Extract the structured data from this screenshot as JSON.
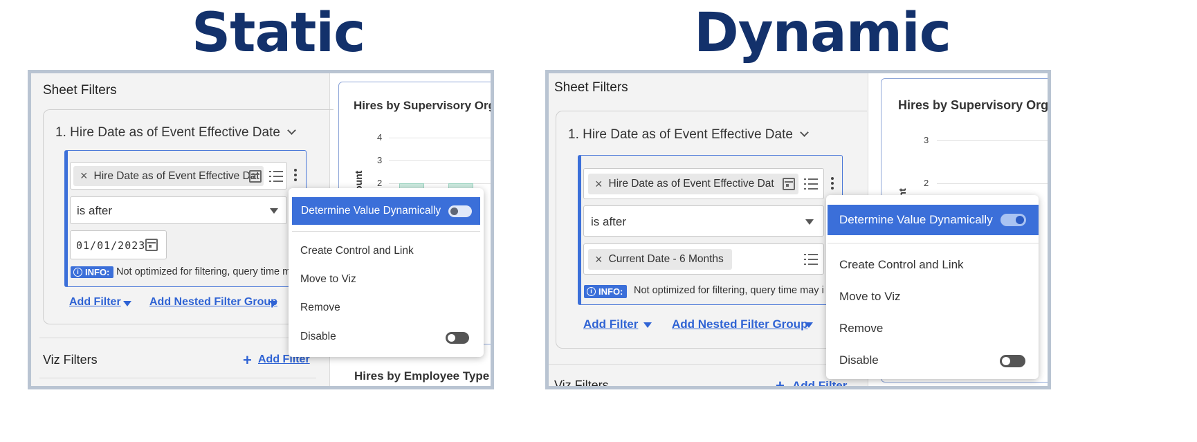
{
  "headings": {
    "static": "Static",
    "dynamic": "Dynamic"
  },
  "colors": {
    "heading": "#13316b",
    "accent": "#3b6fd9",
    "link": "#2f63d4",
    "panel_border": "#b9c4d2",
    "bar_fill": "#cbeadf"
  },
  "static": {
    "sheet_filters_title": "Sheet Filters",
    "filter_name": "1. Hire Date as of Event Effective Date",
    "field_chip": "Hire Date as of Event Effective Dat",
    "operator": "is after",
    "date_value": "01/01/2023",
    "info_label": "INFO:",
    "info_text": "Not optimized for filtering, query time may i...",
    "add_filter": "Add Filter",
    "add_nested": "Add Nested Filter Group",
    "viz_filters_title": "Viz Filters",
    "viz_add_filter": "Add Filter",
    "chart_title": "Hires by Supervisory Orga",
    "chart_y_label": "Count",
    "y_ticks": [
      "4",
      "3",
      "2"
    ],
    "chart2_title": "Hires by  Employee Type",
    "menu": {
      "determine": "Determine Value Dynamically",
      "determine_on": false,
      "create_control": "Create Control and Link",
      "move_to_viz": "Move to Viz",
      "remove": "Remove",
      "disable": "Disable",
      "disable_on": false
    }
  },
  "dynamic": {
    "sheet_filters_title": "Sheet Filters",
    "filter_name": "1. Hire Date as of Event Effective Date",
    "field_chip": "Hire Date as of Event Effective Dat",
    "operator": "is after",
    "value_chip": "Current Date - 6 Months",
    "info_label": "INFO:",
    "info_text": "Not optimized for filtering, query time may i...",
    "add_filter": "Add Filter",
    "add_nested": "Add Nested Filter Group",
    "viz_filters_title": "Viz Filters",
    "viz_add_filter": "Add Filter",
    "chart_title": "Hires by Supervisory Orga",
    "chart_y_label": "unt",
    "y_ticks": [
      "3",
      "2"
    ],
    "menu": {
      "determine": "Determine Value Dynamically",
      "determine_on": true,
      "create_control": "Create Control and Link",
      "move_to_viz": "Move to Viz",
      "remove": "Remove",
      "disable": "Disable",
      "disable_on": false
    }
  }
}
